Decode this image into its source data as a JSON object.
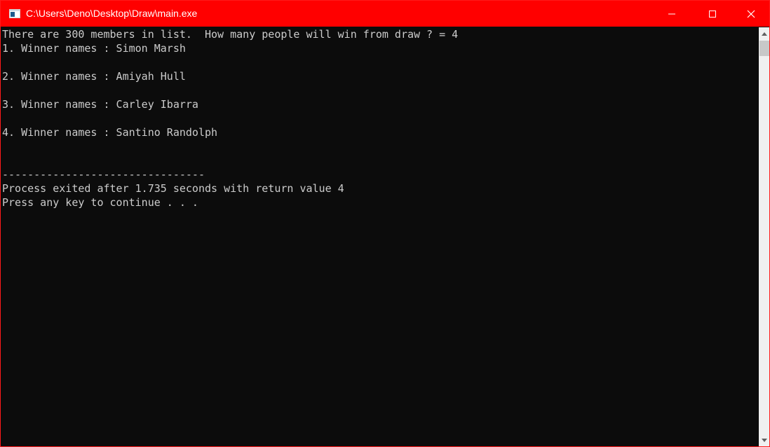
{
  "window": {
    "title": "C:\\Users\\Deno\\Desktop\\Draw\\main.exe",
    "icon": "console-app-icon",
    "controls": {
      "minimize_icon": "minimize-icon",
      "maximize_icon": "maximize-icon",
      "close_icon": "close-icon"
    },
    "accent_color": "#ff0000"
  },
  "console": {
    "background": "#0c0c0c",
    "foreground": "#cccccc",
    "lines": [
      "There are 300 members in list.  How many people will win from draw ? = 4",
      "1. Winner names : Simon Marsh",
      "",
      "2. Winner names : Amiyah Hull",
      "",
      "3. Winner names : Carley Ibarra",
      "",
      "4. Winner names : Santino Randolph",
      "",
      "",
      "--------------------------------",
      "Process exited after 1.735 seconds with return value 4",
      "Press any key to continue . . ."
    ]
  }
}
